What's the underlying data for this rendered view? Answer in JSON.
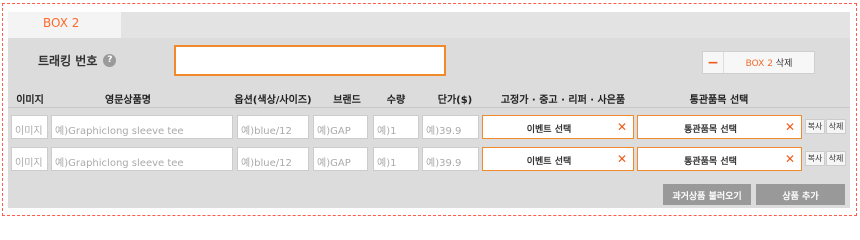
{
  "box": {
    "tab_label": "BOX 2"
  },
  "tracking": {
    "label": "트래킹 번호",
    "help_icon_glyph": "?",
    "value": ""
  },
  "delete_box": {
    "minus_glyph": "−",
    "box_name": "BOX 2",
    "action": "삭제"
  },
  "columns": [
    "이미지",
    "영문상품명",
    "옵션(색상/사이즈)",
    "브랜드",
    "수량",
    "단가($)",
    "고정가 · 중고 · 리퍼 · 사은품",
    "통관품목 선택"
  ],
  "rows": [
    {
      "image": "이미지",
      "product_name": "예)Graphiclong sleeve tee",
      "option": "예)blue/12",
      "brand": "예)GAP",
      "qty": "예)1",
      "price": "예)39.9",
      "event_select": "이벤트 선택",
      "customs_select": "통관품목 선택",
      "copy": "복사",
      "delete": "삭제"
    },
    {
      "image": "이미지",
      "product_name": "예)Graphiclong sleeve tee",
      "option": "예)blue/12",
      "brand": "예)GAP",
      "qty": "예)1",
      "price": "예)39.9",
      "event_select": "이벤트 선택",
      "customs_select": "통관품목 선택",
      "copy": "복사",
      "delete": "삭제"
    }
  ],
  "clear_glyph": "✕",
  "buttons": {
    "load_past": "과거상품 불러오기",
    "add_product": "상품 추가"
  },
  "colors": {
    "accent": "#f08a2c",
    "tab_text": "#ff6a2a",
    "panel": "#dcdcdc",
    "button": "#999999",
    "frame_dash": "#ff5a4a"
  }
}
